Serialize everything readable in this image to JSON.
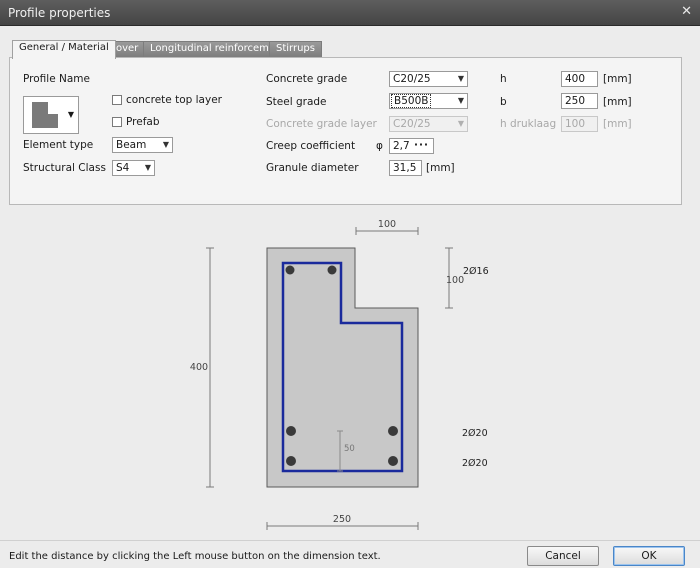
{
  "window": {
    "title": "Profile properties",
    "close_glyph": "✕"
  },
  "tabs": [
    {
      "label": "General / Material",
      "active": true
    },
    {
      "label": "Cover"
    },
    {
      "label": "Longitudinal reinforcement"
    },
    {
      "label": "Stirrups"
    }
  ],
  "general": {
    "profile_name_label": "Profile Name",
    "concrete_top_layer_label": "concrete top layer",
    "concrete_top_layer_checked": false,
    "prefab_label": "Prefab",
    "prefab_checked": false,
    "element_type_label": "Element type",
    "element_type_value": "Beam",
    "structural_class_label": "Structural Class",
    "structural_class_value": "S4",
    "concrete_grade_label": "Concrete grade",
    "concrete_grade_value": "C20/25",
    "steel_grade_label": "Steel grade",
    "steel_grade_value": "B500B",
    "concrete_grade_layer_label": "Concrete grade layer",
    "concrete_grade_layer_value": "C20/25",
    "creep_coefficient_label": "Creep coefficient",
    "creep_symbol": "φ",
    "creep_coefficient_value": "2,7",
    "creep_button": "···",
    "granule_diameter_label": "Granule diameter",
    "granule_diameter_value": "31,5",
    "granule_unit": "[mm]",
    "h_label": "h",
    "h_value": "400",
    "h_unit": "[mm]",
    "b_label": "b",
    "b_value": "250",
    "b_unit": "[mm]",
    "h_druklaag_label": "h druklaag",
    "h_druklaag_value": "100",
    "h_druklaag_unit": "[mm]"
  },
  "drawing": {
    "dim_top": "100",
    "dim_right": "100",
    "dim_left": "400",
    "dim_bottom": "250",
    "dim_inner": "50",
    "rebar_top": "2Ø16",
    "rebar_mid": "2Ø20",
    "rebar_bottom": "2Ø20",
    "colors": {
      "concrete": "#c8c8c8",
      "stirrup": "#1a2a9c",
      "bar": "#3a3a3a"
    }
  },
  "status": {
    "text": "Edit the distance by clicking the Left mouse button on the dimension text.",
    "cancel_label": "Cancel",
    "ok_label": "OK"
  }
}
